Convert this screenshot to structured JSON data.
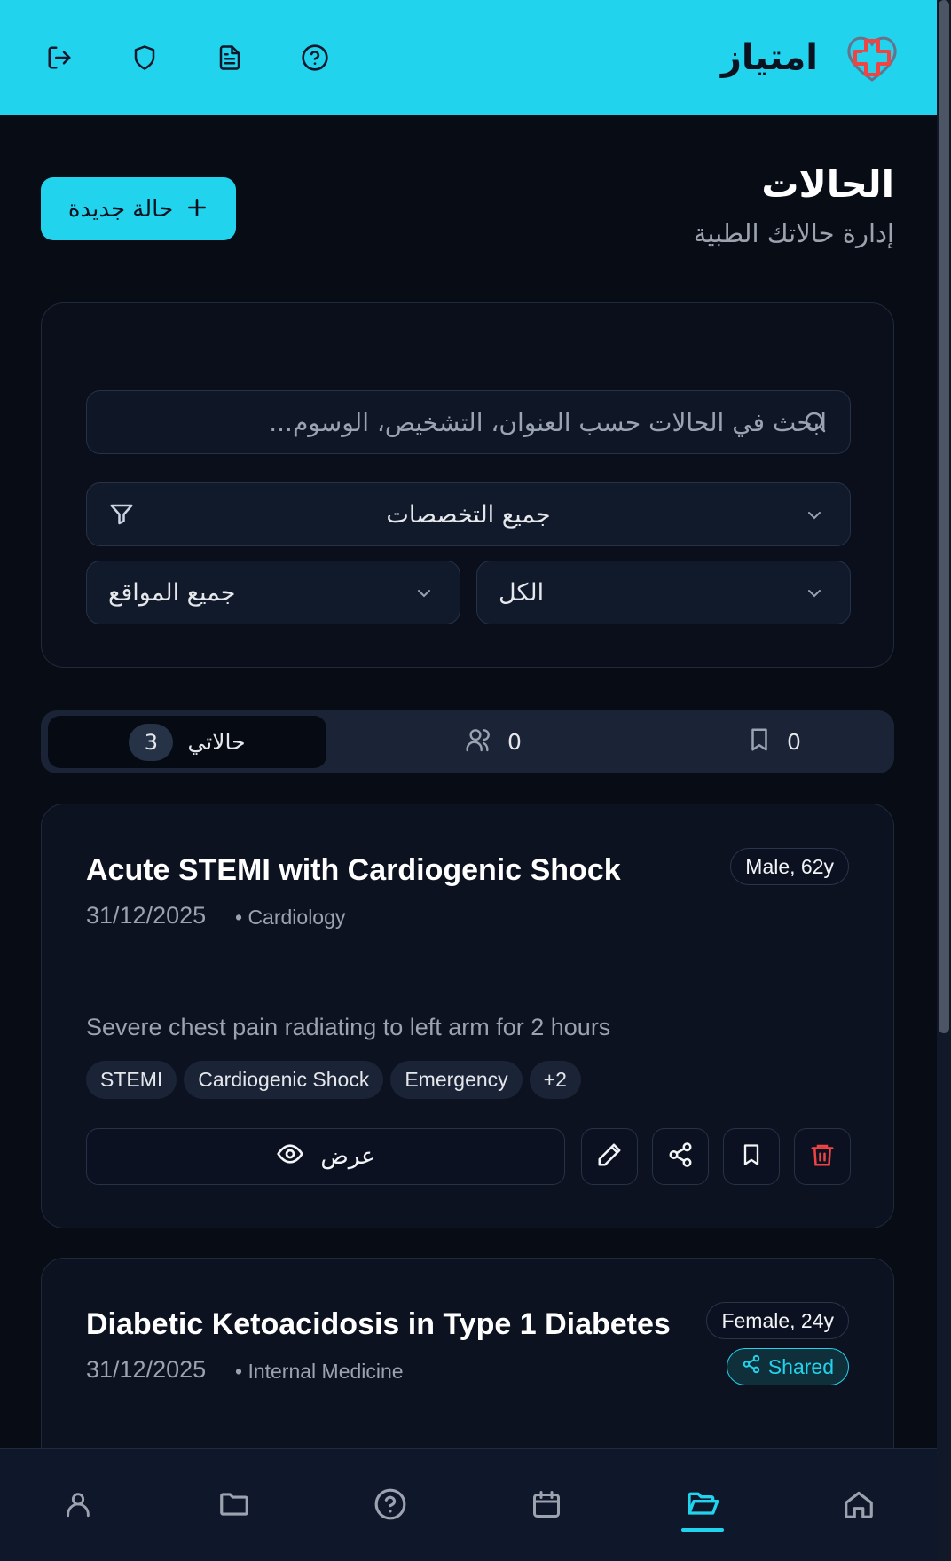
{
  "app": {
    "brand_name": "امتياز",
    "brand_colors": {
      "accent": "#22d3ee",
      "logo_red": "#ef4444",
      "logo_cyan": "#22d3ee"
    }
  },
  "header": {
    "icons": [
      "logout-icon",
      "shield-icon",
      "document-icon",
      "help-icon"
    ]
  },
  "page": {
    "title": "الحالات",
    "subtitle": "إدارة حالاتك الطبية",
    "new_case_label": "حالة جديدة"
  },
  "filters": {
    "search_placeholder": "ابحث في الحالات حسب العنوان، التشخيص، الوسوم...",
    "specialty_value": "جميع التخصصات",
    "location_value": "جميع المواقع",
    "status_value": "الكل"
  },
  "tabs": {
    "mine_label": "حالاتي",
    "mine_count": "3",
    "shared_count": "0",
    "saved_count": "0"
  },
  "cases": [
    {
      "title": "Acute STEMI with Cardiogenic Shock",
      "date": "31/12/2025",
      "specialty": "• Cardiology",
      "demographics": "Male, 62y",
      "description": "Severe chest pain radiating to left arm for 2 hours",
      "tags": [
        "STEMI",
        "Cardiogenic Shock",
        "Emergency",
        "+2"
      ],
      "view_label": "عرض"
    },
    {
      "title": "Diabetic Ketoacidosis in Type 1 Diabetes",
      "date": "31/12/2025",
      "specialty": "• Internal Medicine",
      "demographics": "Female, 24y",
      "shared_label": "Shared"
    }
  ],
  "bottom_nav": {
    "items": [
      "profile-icon",
      "folder-icon",
      "help-icon",
      "calendar-icon",
      "folder-open-icon",
      "home-icon"
    ],
    "active": "folder-open-icon"
  }
}
